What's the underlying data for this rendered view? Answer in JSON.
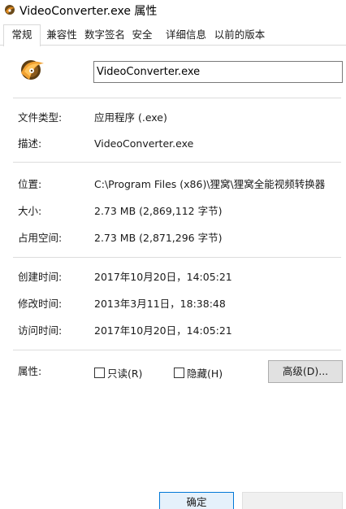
{
  "window": {
    "title": "VideoConverter.exe 属性"
  },
  "tabs": [
    {
      "label": "常规",
      "active": true
    },
    {
      "label": "兼容性",
      "active": false
    },
    {
      "label": "数字签名",
      "active": false
    },
    {
      "label": "安全",
      "active": false
    },
    {
      "label": "详细信息",
      "active": false
    },
    {
      "label": "以前的版本",
      "active": false
    }
  ],
  "general": {
    "file_name": "VideoConverter.exe",
    "file_type_label": "文件类型:",
    "file_type_value": "应用程序 (.exe)",
    "description_label": "描述:",
    "description_value": "VideoConverter.exe",
    "location_label": "位置:",
    "location_value": "C:\\Program Files (x86)\\狸窝\\狸窝全能视频转换器",
    "size_label": "大小:",
    "size_value": "2.73 MB (2,869,112 字节)",
    "size_on_disk_label": "占用空间:",
    "size_on_disk_value": "2.73 MB (2,871,296 字节)",
    "created_label": "创建时间:",
    "created_value": "2017年10月20日，14:05:21",
    "modified_label": "修改时间:",
    "modified_value": "2013年3月11日，18:38:48",
    "accessed_label": "访问时间:",
    "accessed_value": "2017年10月20日，14:05:21",
    "attributes_label": "属性:",
    "readonly_label": "只读(R)",
    "readonly_checked": false,
    "hidden_label": "隐藏(H)",
    "hidden_checked": false,
    "advanced_button": "高级(D)..."
  },
  "footer": {
    "ok_button": "确定",
    "cancel_button": ""
  },
  "colors": {
    "app_icon_primary": "#e08a1e",
    "app_icon_dark": "#6b4a1a",
    "accent": "#0078d7"
  },
  "icons": {
    "title_icon": "video-converter-app-icon",
    "file_icon": "video-converter-app-icon"
  }
}
